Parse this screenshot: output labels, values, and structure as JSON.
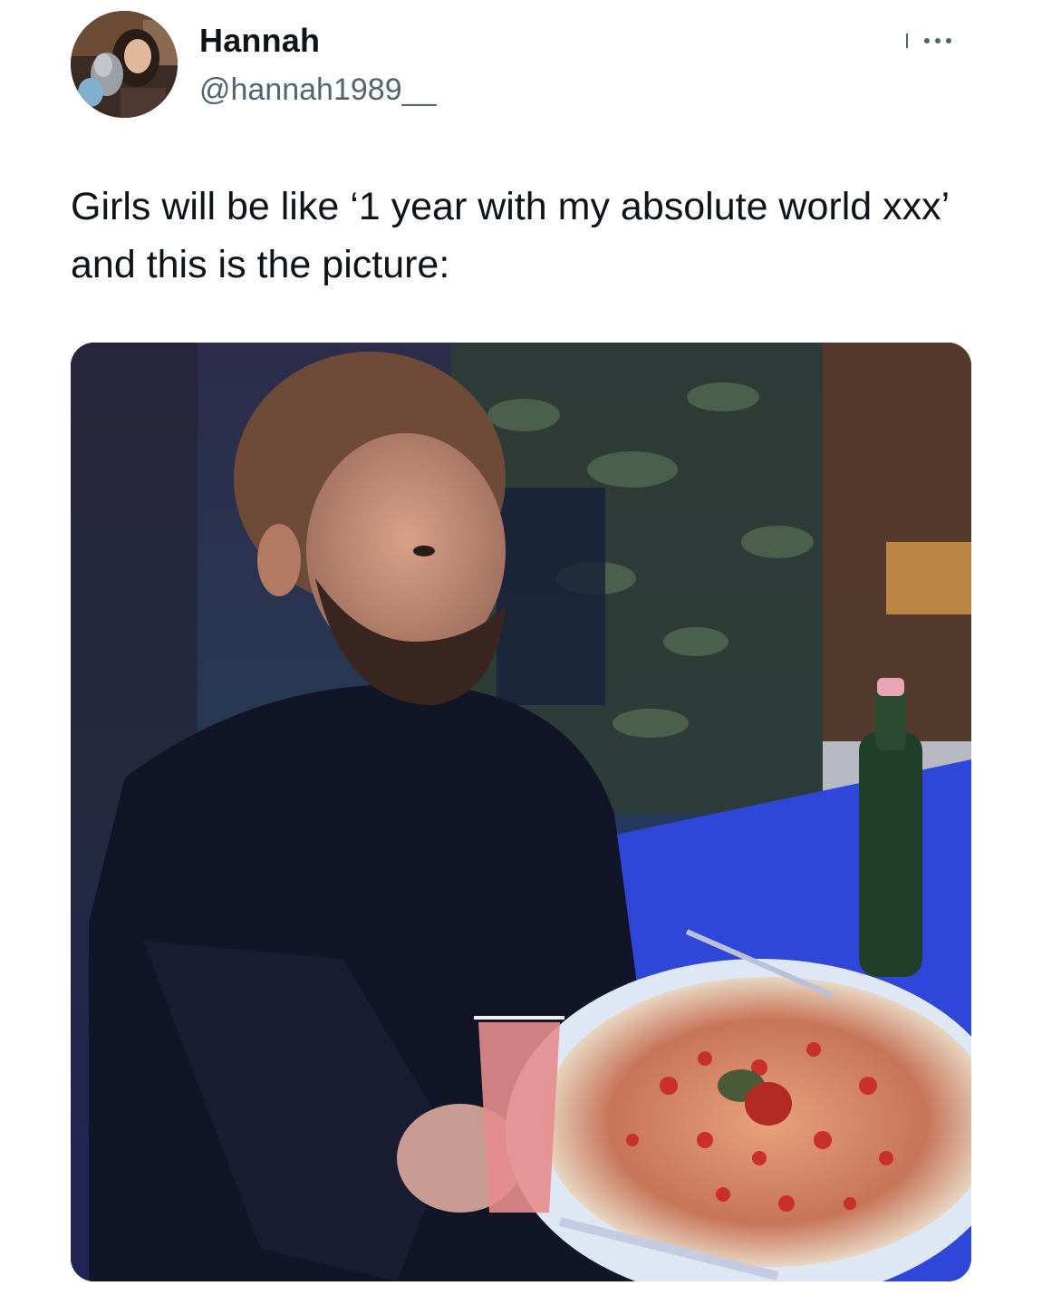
{
  "tweet": {
    "author": {
      "display_name": "Hannah",
      "handle": "@hannah1989__",
      "avatar_icon": "profile-photo"
    },
    "more_icon": "more-options-icon",
    "text": "Girls will be like ‘1 year with my absolute world xxx’ and this is the picture:",
    "media": {
      "type": "photo",
      "icon": "attached-photo"
    }
  },
  "colors": {
    "primary_text": "#0f1419",
    "secondary_text": "#536471",
    "background": "#ffffff"
  }
}
